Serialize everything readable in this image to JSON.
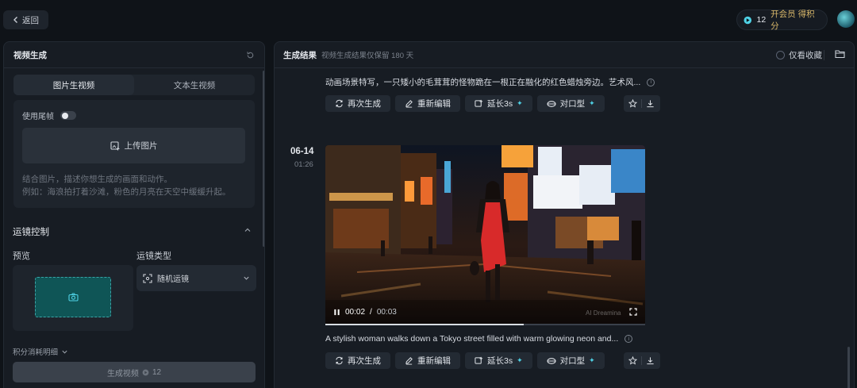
{
  "topbar": {
    "back_label": "返回",
    "credits": "12",
    "member_label": "开会员 得积分"
  },
  "left": {
    "title": "视频生成",
    "tabs": [
      {
        "label": "图片生视频",
        "active": true
      },
      {
        "label": "文本生视频",
        "active": false
      }
    ],
    "tail_frame_label": "使用尾帧",
    "upload_label": "上传图片",
    "hint_line1": "结合图片，描述你想生成的画面和动作。",
    "hint_line2": "例如：海浪拍打着沙滩，粉色的月亮在天空中缓缓升起。",
    "camera_title": "运镜控制",
    "preview_label": "预览",
    "camera_type_label": "运镜类型",
    "camera_type_value": "随机运镜",
    "cost_detail_label": "积分消耗明细",
    "generate_label": "生成视频",
    "generate_cost": "12"
  },
  "right": {
    "title": "生成结果",
    "subtitle": "视频生成结果仅保留 180 天",
    "fav_only_label": "仅看收藏",
    "items": [
      {
        "prompt": "动画场景特写，一只矮小的毛茸茸的怪物跪在一根正在融化的红色蜡烛旁边。艺术风..."
      },
      {
        "date": "06-14",
        "time": "01:26",
        "prompt": "A stylish woman walks down a Tokyo street filled with warm glowing neon and...",
        "current_time": "00:02",
        "duration": "00:03",
        "progress": 0.62
      }
    ],
    "actions": {
      "regenerate": "再次生成",
      "reedit": "重新编辑",
      "extend": "延长3s",
      "lipsync": "对口型"
    },
    "time_sep": "/",
    "watermark": "AI Dreamina"
  },
  "colors": {
    "accent": "#4fd2e6",
    "member": "#d9b86a",
    "panel": "#171c23",
    "bg": "#0f1318"
  }
}
